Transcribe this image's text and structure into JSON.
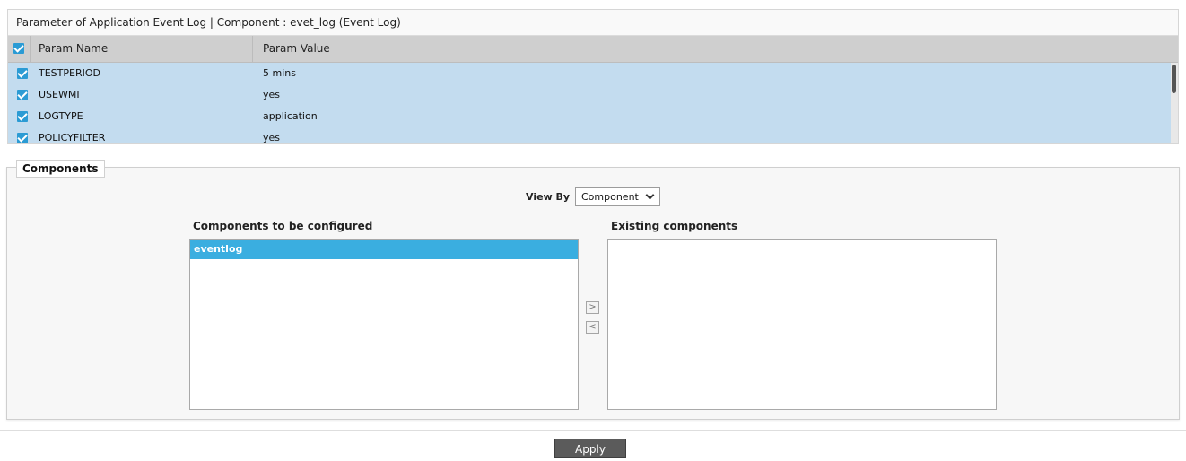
{
  "param_panel": {
    "title": "Parameter of Application Event Log | Component : evet_log (Event Log)",
    "columns": {
      "name": "Param Name",
      "value": "Param Value"
    },
    "rows": [
      {
        "name": "TESTPERIOD",
        "value": "5 mins",
        "checked": true
      },
      {
        "name": "USEWMI",
        "value": "yes",
        "checked": true
      },
      {
        "name": "LOGTYPE",
        "value": "application",
        "checked": true
      },
      {
        "name": "POLICYFILTER",
        "value": "yes",
        "checked": true
      }
    ]
  },
  "components": {
    "legend": "Components",
    "view_by_label": "View By",
    "view_by_selected": "Component",
    "to_configure_label": "Components to be configured",
    "to_configure_items": [
      "eventlog"
    ],
    "existing_label": "Existing components",
    "existing_items": [],
    "move_right_symbol": ">",
    "move_left_symbol": "<"
  },
  "footer": {
    "apply_label": "Apply"
  },
  "colors": {
    "selection_blue": "#3aaee0",
    "row_blue": "#c3dcef",
    "checkbox_blue": "#2b9bd4"
  }
}
